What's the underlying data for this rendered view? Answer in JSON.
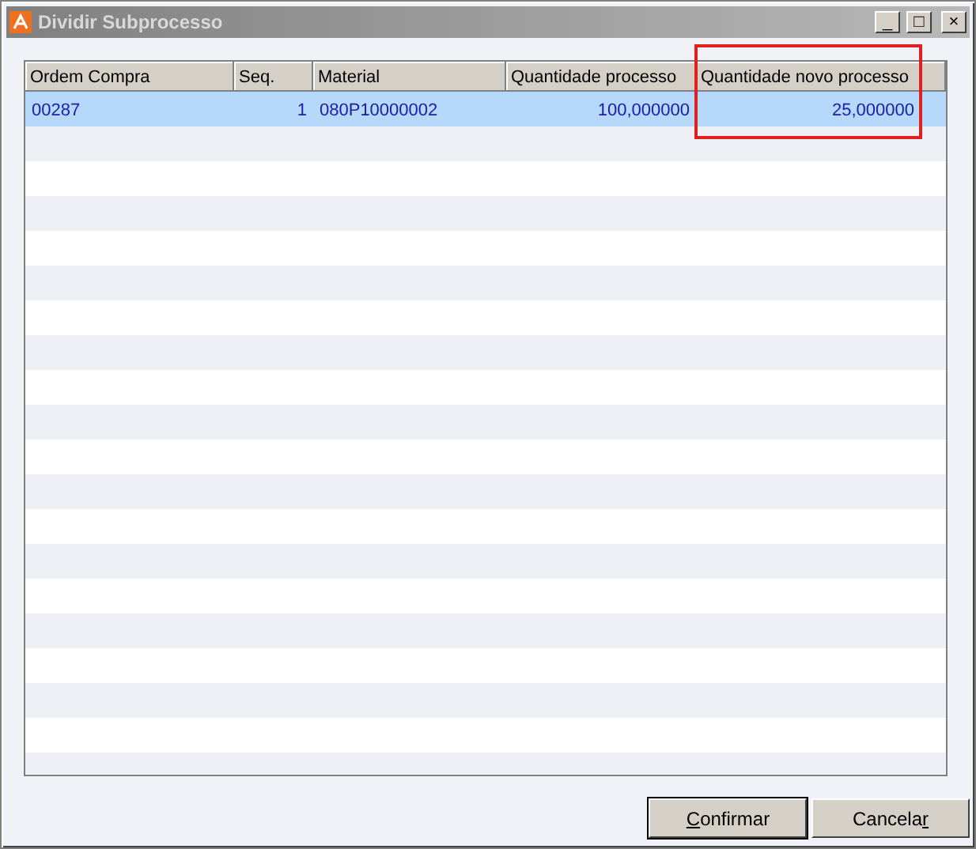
{
  "window": {
    "title": "Dividir Subprocesso",
    "controls": [
      "_",
      "□",
      "×"
    ]
  },
  "table": {
    "columns": [
      {
        "label": "Ordem Compra"
      },
      {
        "label": "Seq."
      },
      {
        "label": "Material"
      },
      {
        "label": "Quantidade processo"
      },
      {
        "label": "Quantidade novo processo",
        "highlighted": true
      }
    ],
    "rows": [
      {
        "cells": [
          "00287",
          "1",
          "080P10000002",
          "100,000000",
          "25,000000"
        ],
        "selected": true
      }
    ]
  },
  "buttons": [
    {
      "mnemonic": "C",
      "label_after": "onfirmar",
      "default": true
    },
    {
      "label_before": "Cancela",
      "mnemonic": "r",
      "default": false
    }
  ]
}
